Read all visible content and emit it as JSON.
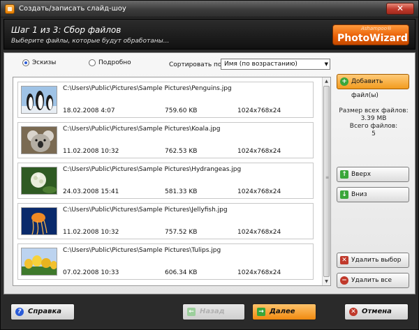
{
  "window": {
    "title": "Создать/записать слайд-шоу",
    "close_icon": "✕"
  },
  "header": {
    "step_title": "Шаг 1 из 3: Сбор файлов",
    "subtitle": "Выберите файлы, которые будут обработаны...",
    "logo_brand": "Ashampoo®",
    "logo_product": "PhotoWizard"
  },
  "view": {
    "thumbnails_label": "Эскизы",
    "details_label": "Подробно",
    "selected": "thumbnails",
    "sort_label": "Сортировать по:",
    "sort_value": "Имя (по возрастанию)"
  },
  "files": [
    {
      "path": "C:\\Users\\Public\\Pictures\\Sample Pictures\\Penguins.jpg",
      "date": "18.02.2008 4:07",
      "size": "759.60 KB",
      "dims": "1024x768x24",
      "thumb": "penguins"
    },
    {
      "path": "C:\\Users\\Public\\Pictures\\Sample Pictures\\Koala.jpg",
      "date": "11.02.2008 10:32",
      "size": "762.53 KB",
      "dims": "1024x768x24",
      "thumb": "koala"
    },
    {
      "path": "C:\\Users\\Public\\Pictures\\Sample Pictures\\Hydrangeas.jpg",
      "date": "24.03.2008 15:41",
      "size": "581.33 KB",
      "dims": "1024x768x24",
      "thumb": "hydrangeas"
    },
    {
      "path": "C:\\Users\\Public\\Pictures\\Sample Pictures\\Jellyfish.jpg",
      "date": "11.02.2008 10:32",
      "size": "757.52 KB",
      "dims": "1024x768x24",
      "thumb": "jellyfish"
    },
    {
      "path": "C:\\Users\\Public\\Pictures\\Sample Pictures\\Tulips.jpg",
      "date": "07.02.2008 10:33",
      "size": "606.34 KB",
      "dims": "1024x768x24",
      "thumb": "tulips"
    }
  ],
  "sidebar": {
    "add_files": "Добавить файл(ы)",
    "total_size_label": "Размер всех файлов:",
    "total_size_value": "3.39 MB",
    "total_files_label": "Всего файлов:",
    "total_files_value": "5",
    "up": "Вверх",
    "down": "Вниз",
    "remove_selected": "Удалить выбор",
    "remove_all": "Удалить все"
  },
  "footer": {
    "help": "Справка",
    "back": "Назад",
    "next": "Далее",
    "cancel": "Отмена"
  },
  "colors": {
    "accent_orange": "#f29b1e",
    "header_dark": "#111111"
  }
}
